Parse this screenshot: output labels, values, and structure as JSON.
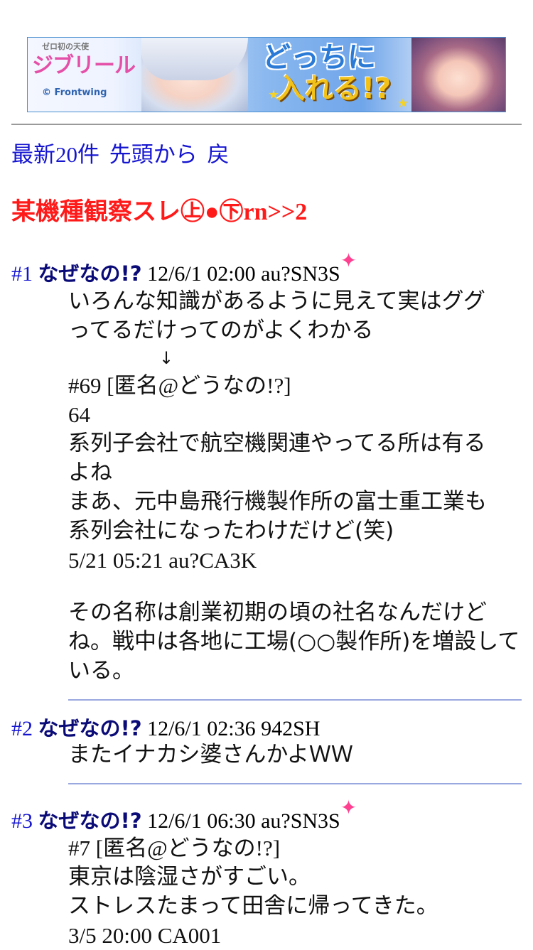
{
  "banner": {
    "logo_small": "ゼロ初の天使",
    "logo": "ジブリール",
    "brand": "© Frontwing",
    "catch_line1": "どっちに",
    "catch_line2": "入れる!?"
  },
  "nav": {
    "latest": "最新20件",
    "from_top": "先頭から",
    "back": "戻"
  },
  "thread": {
    "title": "某機種観察スレ㊤●㊦rn>>2"
  },
  "posts": [
    {
      "number": "#1",
      "name": "なぜなの!?",
      "meta": "12/6/1 02:00 au?SN3S",
      "has_spark": true,
      "lines": [
        "いろんな知識があるように見えて実はググ",
        "ってるだけってのがよくわかる",
        "↓",
        "#69 [匿名@どうなの!?]",
        "64",
        "系列子会社で航空機関連やってる所は有る",
        "よね",
        "まあ、元中島飛行機製作所の富士重工業も",
        "系列会社になったわけだけど(笑)",
        "5/21 05:21 au?CA3K",
        "その名称は創業初期の頃の社名なんだけど",
        "ね。戦中は各地に工場(○○製作所)を増設して",
        "いる。"
      ]
    },
    {
      "number": "#2",
      "name": "なぜなの!?",
      "meta": "12/6/1 02:36 942SH",
      "has_spark": false,
      "lines": [
        "またイナカシ婆さんかよＷＷ"
      ]
    },
    {
      "number": "#3",
      "name": "なぜなの!?",
      "meta": "12/6/1 06:30 au?SN3S",
      "has_spark": true,
      "lines": [
        "#7 [匿名@どうなの!?]",
        "東京は陰湿さがすごい。",
        "ストレスたまって田舎に帰ってきた。",
        "3/5 20:00 CA001"
      ]
    }
  ],
  "spark_glyph": "✦",
  "colors": {
    "link": "#1515d0",
    "title": "#ff1a1a",
    "name": "#0b0b78",
    "spark": "#ff3f8f",
    "separator": "#9aa8e0"
  }
}
